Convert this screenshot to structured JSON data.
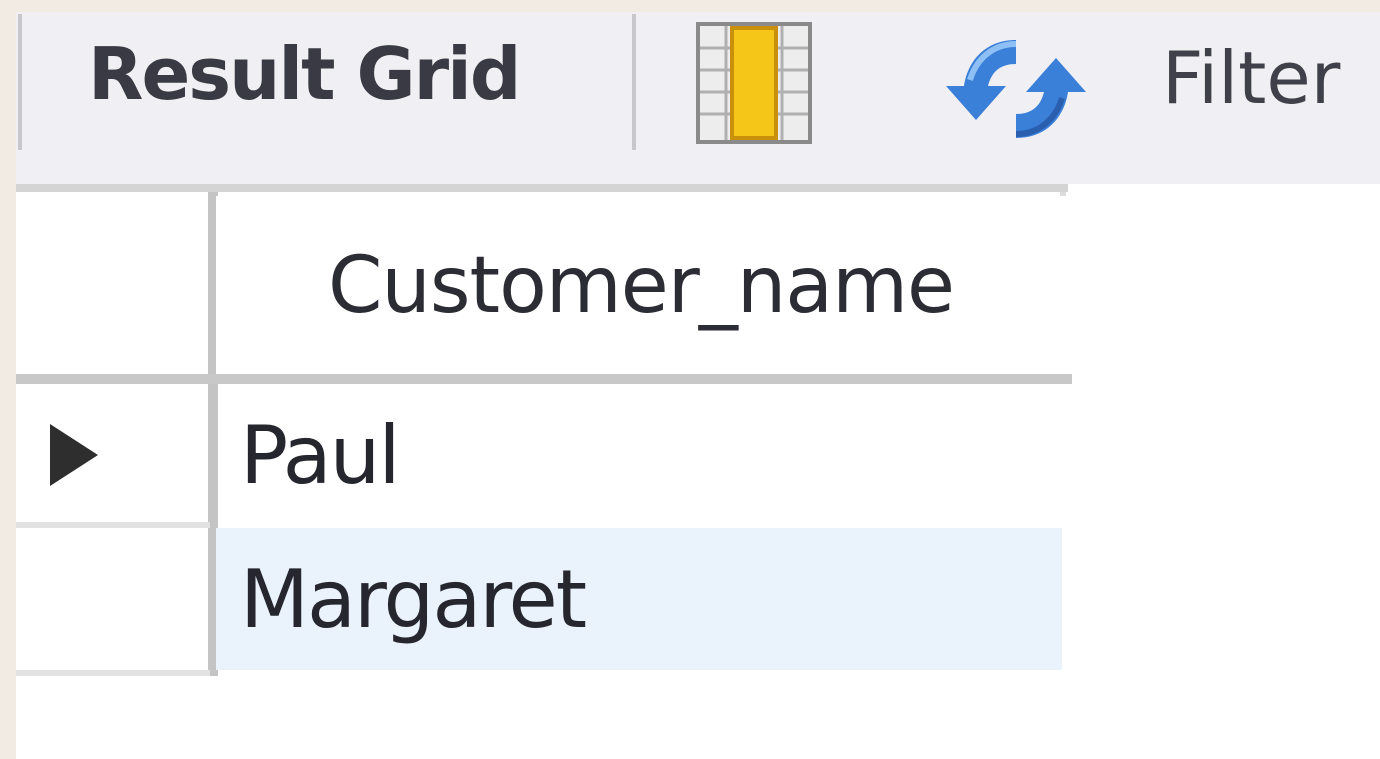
{
  "toolbar": {
    "result_grid_label": "Result Grid",
    "filter_label": "Filter",
    "grid_icon": "grid-column-icon",
    "refresh_icon": "refresh-icon"
  },
  "grid": {
    "columns": [
      "Customer_name"
    ],
    "rows": [
      {
        "customer_name": "Paul",
        "current": true
      },
      {
        "customer_name": "Margaret",
        "current": false
      }
    ]
  },
  "colors": {
    "toolbar_bg": "#f0f0f4",
    "selected_row_bg": "#eaf2fb",
    "grid_icon_accent": "#f5c518",
    "refresh_icon_accent": "#3a7fd8"
  }
}
